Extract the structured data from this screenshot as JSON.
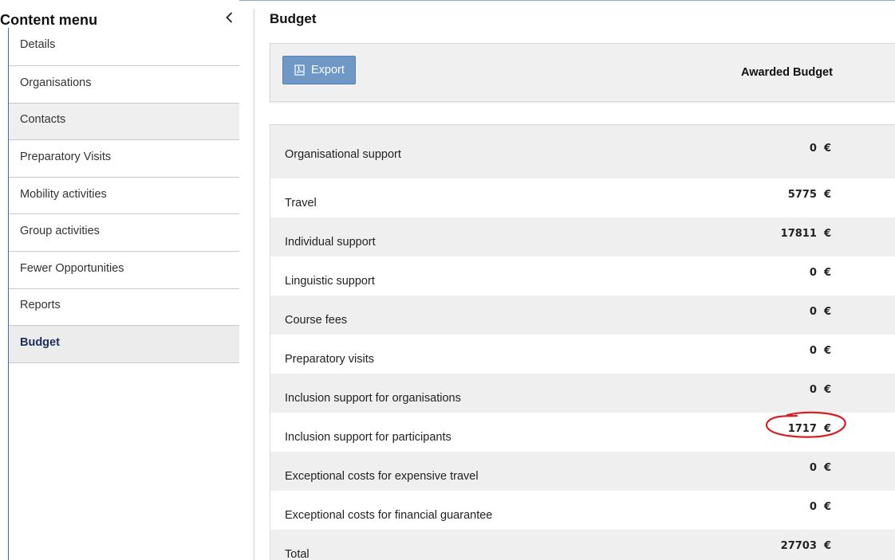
{
  "sidebar": {
    "title": "Content menu",
    "items": [
      {
        "label": "Details"
      },
      {
        "label": "Organisations"
      },
      {
        "label": "Contacts"
      },
      {
        "label": "Preparatory Visits"
      },
      {
        "label": "Mobility activities"
      },
      {
        "label": "Group activities"
      },
      {
        "label": "Fewer Opportunities"
      },
      {
        "label": "Reports"
      },
      {
        "label": "Budget",
        "active": true
      }
    ]
  },
  "main": {
    "title": "Budget",
    "export_label": "Export",
    "column_header": "Awarded Budget",
    "currency": "€",
    "rows": [
      {
        "label": "Organisational support",
        "value": "0"
      },
      {
        "label": "Travel",
        "value": "5775"
      },
      {
        "label": "Individual support",
        "value": "17811"
      },
      {
        "label": "Linguistic support",
        "value": "0"
      },
      {
        "label": "Course fees",
        "value": "0"
      },
      {
        "label": "Preparatory visits",
        "value": "0"
      },
      {
        "label": "Inclusion support for organisations",
        "value": "0"
      },
      {
        "label": "Inclusion support for participants",
        "value": "1717",
        "highlighted": true
      },
      {
        "label": "Exceptional costs for expensive travel",
        "value": "0"
      },
      {
        "label": "Exceptional costs for financial guarantee",
        "value": "0"
      },
      {
        "label": "Total",
        "value": "27703"
      }
    ]
  },
  "colors": {
    "accent": "#6f98c7",
    "active_text": "#1c2e5c",
    "annotation": "#d81f26"
  }
}
